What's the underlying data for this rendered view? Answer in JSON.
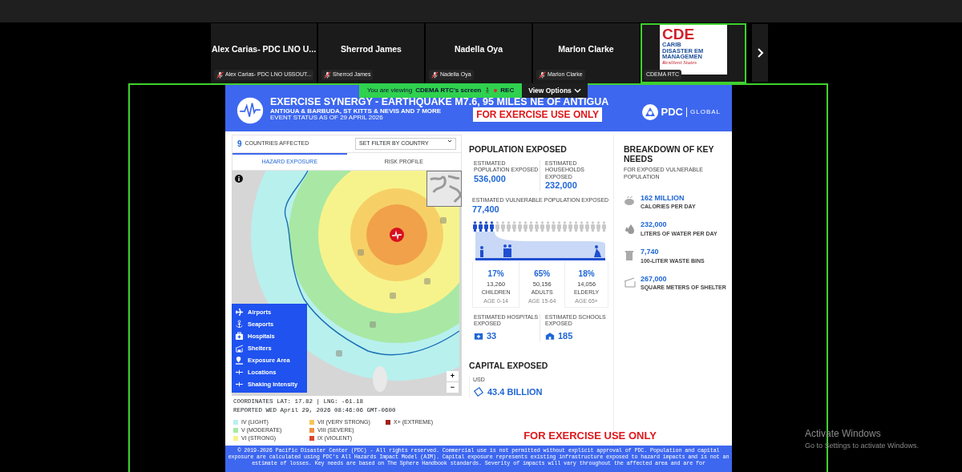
{
  "meeting": {
    "tiles": [
      {
        "kind": "person",
        "name": "Alex Carias- PDC LNO U...",
        "label": "Alex Carias- PDC LNO USSOUT...",
        "muted": true,
        "active": false
      },
      {
        "kind": "person",
        "name": "Sherrod James",
        "label": "Sherrod James",
        "muted": true,
        "active": false
      },
      {
        "kind": "person",
        "name": "Nadella Oya",
        "label": "Nadella Oya",
        "muted": true,
        "active": false
      },
      {
        "kind": "person",
        "name": "Marlon Clarke",
        "label": "Marlon Clarke",
        "muted": true,
        "active": false
      },
      {
        "kind": "logo",
        "logo_lines": [
          "CDE",
          "CARIB",
          "DISASTER EM",
          "MANAGEMEN",
          "Resilient States"
        ],
        "label": "CDEMA RTC",
        "muted": false,
        "active": true
      }
    ]
  },
  "share_banner": {
    "prefix": "You are viewing",
    "owner": "CDEMA RTC's screen",
    "rec": "REC",
    "view_options": "View Options"
  },
  "dashboard": {
    "header": {
      "title": "EXERCISE SYNERGY - EARTHQUAKE M7.6, 95 MILES NE OF ANTIGUA",
      "subtitle": "ANTIGUA & BARBUDA, ST KITTS & NEVIS AND 7 MORE",
      "status": "EVENT STATUS AS OF 29 APRIL 2026",
      "notice": "FOR EXERCISE USE ONLY",
      "brand": "PDC",
      "brand_sub": "GLOBAL"
    },
    "hazard": {
      "count": "9",
      "count_label": "COUNTRIES AFFECTED",
      "filter": "SET FILTER BY COUNTRY",
      "tabs": [
        {
          "label": "HAZARD EXPOSURE",
          "selected": true
        },
        {
          "label": "RISK PROFILE",
          "selected": false
        }
      ],
      "layers": [
        {
          "kind": "airport",
          "label": "Airports"
        },
        {
          "kind": "seaport",
          "label": "Seaports"
        },
        {
          "kind": "hospital",
          "label": "Hospitals"
        },
        {
          "kind": "shelter",
          "label": "Shelters"
        },
        {
          "kind": "area",
          "label": "Exposure Area"
        },
        {
          "kind": "location",
          "label": "Locations"
        },
        {
          "kind": "location",
          "label": "Shaking Intensity"
        }
      ],
      "zoom_in": "+",
      "zoom_out": "−",
      "coordinates": "COORDINATES LAT: 17.82 | LNG: -61.18",
      "reported": "REPORTED WED April 29, 2026 08:46:06 GMT-0600",
      "legend": [
        {
          "label": "IV (LIGHT)",
          "color": "#b8f0ee"
        },
        {
          "label": "V (MODERATE)",
          "color": "#a8e8a4"
        },
        {
          "label": "VI (STRONG)",
          "color": "#f7f38c"
        },
        {
          "label": "VII (VERY STRONG)",
          "color": "#f5c45a"
        },
        {
          "label": "VIII (SEVERE)",
          "color": "#ef9142"
        },
        {
          "label": "IX (VIOLENT)",
          "color": "#d9452c"
        },
        {
          "label": "X+ (EXTREME)",
          "color": "#a2201c"
        }
      ]
    },
    "population": {
      "title": "POPULATION EXPOSED",
      "stats": [
        {
          "label": "ESTIMATED POPULATION EXPOSED",
          "value": "536,000"
        },
        {
          "label": "ESTIMATED HOUSEHOLDS EXPOSED",
          "value": "232,000"
        }
      ],
      "vulnerable_label": "ESTIMATED VULNERABLE POPULATION EXPOSED",
      "vulnerable_value": "77,400",
      "level": 0.167,
      "ages": [
        {
          "percent": "17%",
          "count": "13,260",
          "group": "CHILDREN",
          "range": "AGE 0-14"
        },
        {
          "percent": "65%",
          "count": "50,156",
          "group": "ADULTS",
          "range": "AGE 15-64"
        },
        {
          "percent": "18%",
          "count": "14,056",
          "group": "ELDERLY",
          "range": "AGE 65+"
        }
      ],
      "facilities": [
        {
          "kind": "hospital",
          "label": "ESTIMATED HOSPITALS EXPOSED",
          "value": "33"
        },
        {
          "kind": "school",
          "label": "ESTIMATED SCHOOLS EXPOSED",
          "value": "185"
        }
      ],
      "capital_title": "CAPITAL EXPOSED",
      "currency": "USD",
      "capital_value": "43.4 BILLION"
    },
    "needs": {
      "title": "BREAKDOWN OF KEY NEEDS",
      "subtitle": "FOR EXPOSED VULNERABLE POPULATION",
      "items": [
        {
          "kind": "food",
          "value": "162 MILLION",
          "label": "CALORIES PER DAY"
        },
        {
          "kind": "water",
          "value": "232,000",
          "label": "LITERS OF WATER PER DAY"
        },
        {
          "kind": "waste",
          "value": "7,740",
          "label": "100-LITER WASTE BINS"
        },
        {
          "kind": "shelter",
          "value": "267,000",
          "label": "SQUARE METERS OF SHELTER"
        }
      ]
    },
    "notice": "FOR EXERCISE USE ONLY",
    "footer": "© 2019-2026 Pacific Disaster Center (PDC) - All rights reserved. Commercial use is not permitted without explicit approval of PDC. Population and capital exposure are calculated using PDC's All Hazards Impact Model (AIM). Capital exposure represents existing infrastructure exposed to hazard impacts and is not an estimate of losses. Key needs are based on The Sphere Handbook standards. Severity of impacts will vary throughout the affected area and are for"
  },
  "os_notice": {
    "title": "Activate Windows",
    "text": "Go to Settings to activate Windows."
  }
}
